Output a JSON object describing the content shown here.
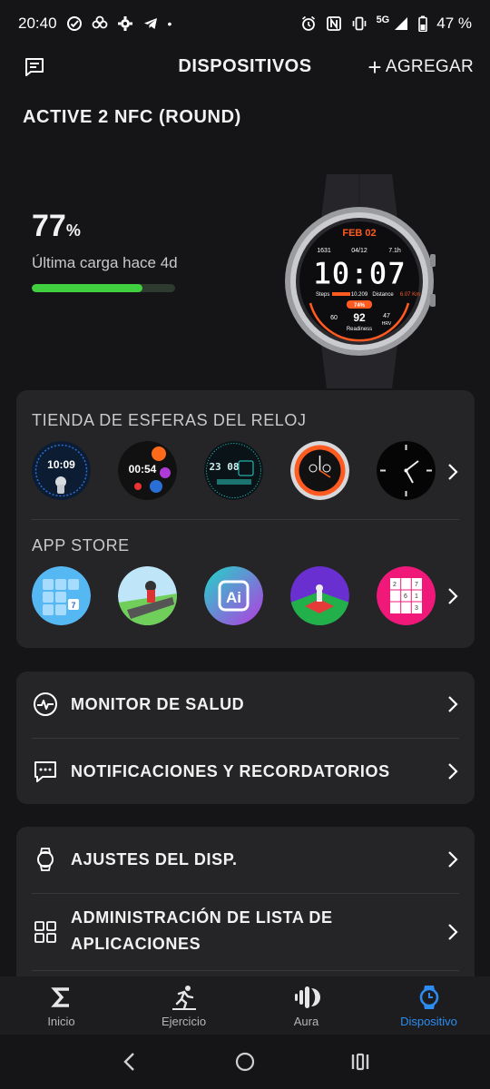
{
  "status_bar": {
    "time": "20:40",
    "network": "5G",
    "battery": "47 %"
  },
  "header": {
    "title": "DISPOSITIVOS",
    "add_label": "AGREGAR"
  },
  "device": {
    "name": "ACTIVE 2 NFC (ROUND)"
  },
  "battery": {
    "percent": "77",
    "percent_symbol": "%",
    "level": 0.77,
    "last_charge": "Última carga hace 4d"
  },
  "watch_face": {
    "date": "FEB 02",
    "time": "10:07",
    "steps_label": "Steps",
    "steps": "10.209",
    "distance_label": "Distance",
    "distance": "6.07 Km",
    "readiness": "92",
    "readiness_label": "Readiness",
    "left_value": "60",
    "right_value": "47",
    "right_label": "HRV",
    "top_values": [
      "1631",
      "04/12",
      "7.1h"
    ],
    "badge": "74%"
  },
  "watch_store": {
    "title": "TIENDA DE ESFERAS DEL RELOJ",
    "items": [
      {
        "name": "watchface-astronaut",
        "time": "10:09"
      },
      {
        "name": "watchface-bubbles",
        "time": "00:54"
      },
      {
        "name": "watchface-digital-grid",
        "time": "23 08"
      },
      {
        "name": "watchface-orange-sport"
      },
      {
        "name": "watchface-classic-analog"
      }
    ]
  },
  "app_store": {
    "title": "APP STORE",
    "items": [
      {
        "name": "app-blocks-game"
      },
      {
        "name": "app-runner-game"
      },
      {
        "name": "app-ai-assistant",
        "label": "Ai"
      },
      {
        "name": "app-chess"
      },
      {
        "name": "app-sudoku"
      }
    ]
  },
  "menu": {
    "health_monitor": "MONITOR DE SALUD",
    "notifications": "NOTIFICACIONES Y RECORDATORIOS",
    "device_settings": "AJUSTES DEL DISP.",
    "app_list_line1": "ADMINISTRACIÓN DE LISTA DE",
    "app_list_line2": "APLICACIONES"
  },
  "bottom_nav": {
    "items": [
      {
        "label": "Inicio",
        "icon": "sigma-icon"
      },
      {
        "label": "Ejercicio",
        "icon": "runner-icon"
      },
      {
        "label": "Aura",
        "icon": "aura-icon"
      },
      {
        "label": "Dispositivo",
        "icon": "watch-icon",
        "active": true
      }
    ]
  },
  "colors": {
    "accent": "#2c8cf0",
    "battery_green": "#3fcf3f",
    "card_bg": "#252528",
    "watch_orange": "#ff5a1f"
  }
}
